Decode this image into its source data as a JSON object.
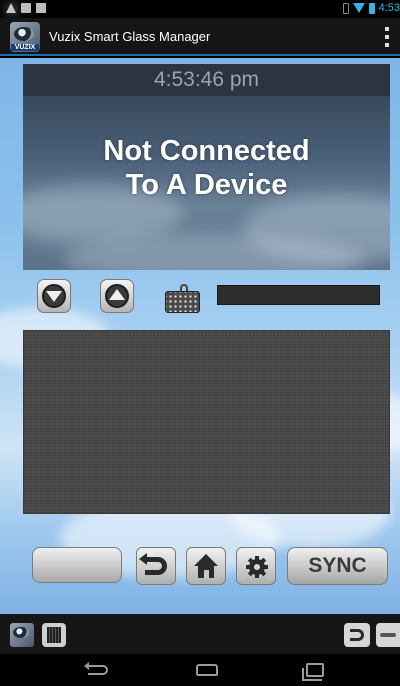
{
  "status_bar": {
    "time": "4:53",
    "icons": [
      "warning-icon",
      "mail-icon",
      "sd-card-icon",
      "cloud-icon",
      "vibrate-icon",
      "wifi-icon",
      "battery-icon"
    ]
  },
  "app_bar": {
    "logo_brand": "VUZIX",
    "title": "Vuzix Smart Glass Manager",
    "menu_icon": "overflow-menu-icon"
  },
  "display": {
    "clock": "4:53:46 pm",
    "status_message": "Not Connected\nTo A Device"
  },
  "controls": {
    "scroll_down_icon": "arrow-down-circle-icon",
    "scroll_up_icon": "arrow-up-circle-icon",
    "keyboard_icon": "keyboard-icon",
    "text_input_value": ""
  },
  "output_panel": {
    "content": ""
  },
  "action_buttons": {
    "blank_label": "",
    "back_icon": "undo-icon",
    "home_icon": "home-icon",
    "settings_icon": "gear-icon",
    "sync_label": "SYNC"
  },
  "bottom_bar": {
    "icons": [
      "vuzix-logo-icon",
      "chip-icon",
      "undo-icon",
      "swipe-icon"
    ]
  },
  "nav_bar": {
    "icons": [
      "back-icon",
      "home-icon",
      "recent-apps-icon"
    ]
  },
  "colors": {
    "accent": "#33b5e5",
    "action_bar_divider": "#1d6fa5",
    "sky": "#8cc1ec"
  }
}
